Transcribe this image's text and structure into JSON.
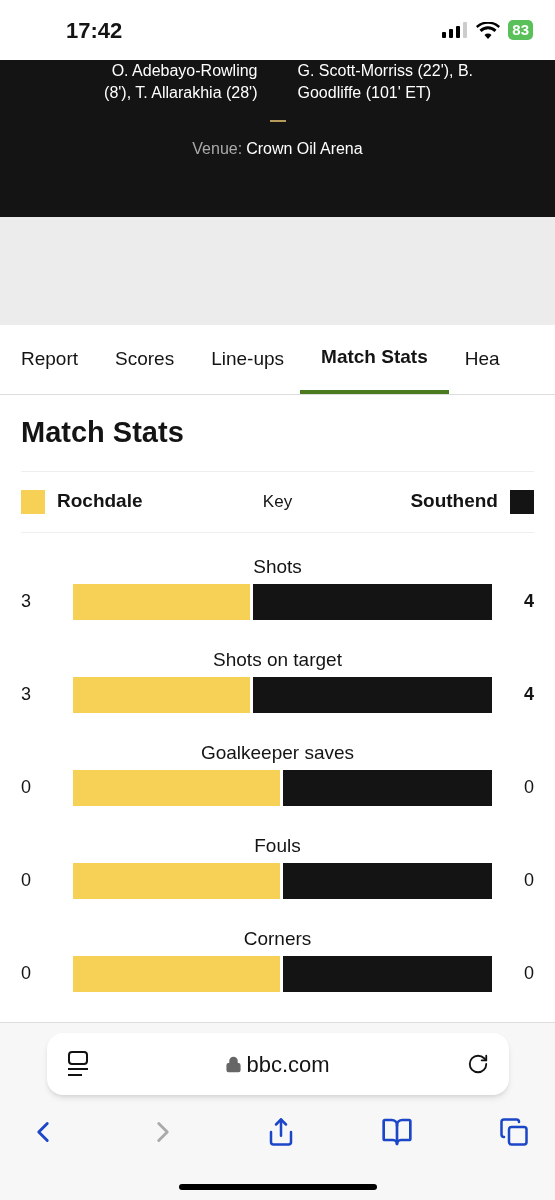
{
  "status_bar": {
    "time": "17:42",
    "battery": "83"
  },
  "match_header": {
    "home_scorers": [
      "O. Adebayo-Rowling",
      "(8'), T. Allarakhia (28')"
    ],
    "away_scorers": [
      "G. Scott-Morriss (22'), B.",
      "Goodliffe (101' ET)"
    ],
    "venue_label": "Venue:",
    "venue": "Crown Oil Arena"
  },
  "tabs": [
    {
      "label": "Report",
      "selected": false
    },
    {
      "label": "Scores",
      "selected": false
    },
    {
      "label": "Line-ups",
      "selected": false
    },
    {
      "label": "Match Stats",
      "selected": true
    },
    {
      "label": "Hea",
      "selected": false
    }
  ],
  "heading": "Match Stats",
  "key": {
    "home": "Rochdale",
    "label": "Key",
    "away": "Southend"
  },
  "stats": [
    {
      "name": "Shots",
      "home": "3",
      "away": "4",
      "level": 0.43,
      "home_bold": false,
      "away_bold": true
    },
    {
      "name": "Shots on target",
      "home": "3",
      "away": "4",
      "level": 0.43,
      "home_bold": false,
      "away_bold": true
    },
    {
      "name": "Goalkeeper saves",
      "home": "0",
      "away": "0",
      "level": 0.5,
      "home_bold": false,
      "away_bold": false
    },
    {
      "name": "Fouls",
      "home": "0",
      "away": "0",
      "level": 0.5,
      "home_bold": false,
      "away_bold": false
    },
    {
      "name": "Corners",
      "home": "0",
      "away": "0",
      "level": 0.5,
      "home_bold": false,
      "away_bold": false
    }
  ],
  "browser": {
    "url": "bbc.com"
  }
}
